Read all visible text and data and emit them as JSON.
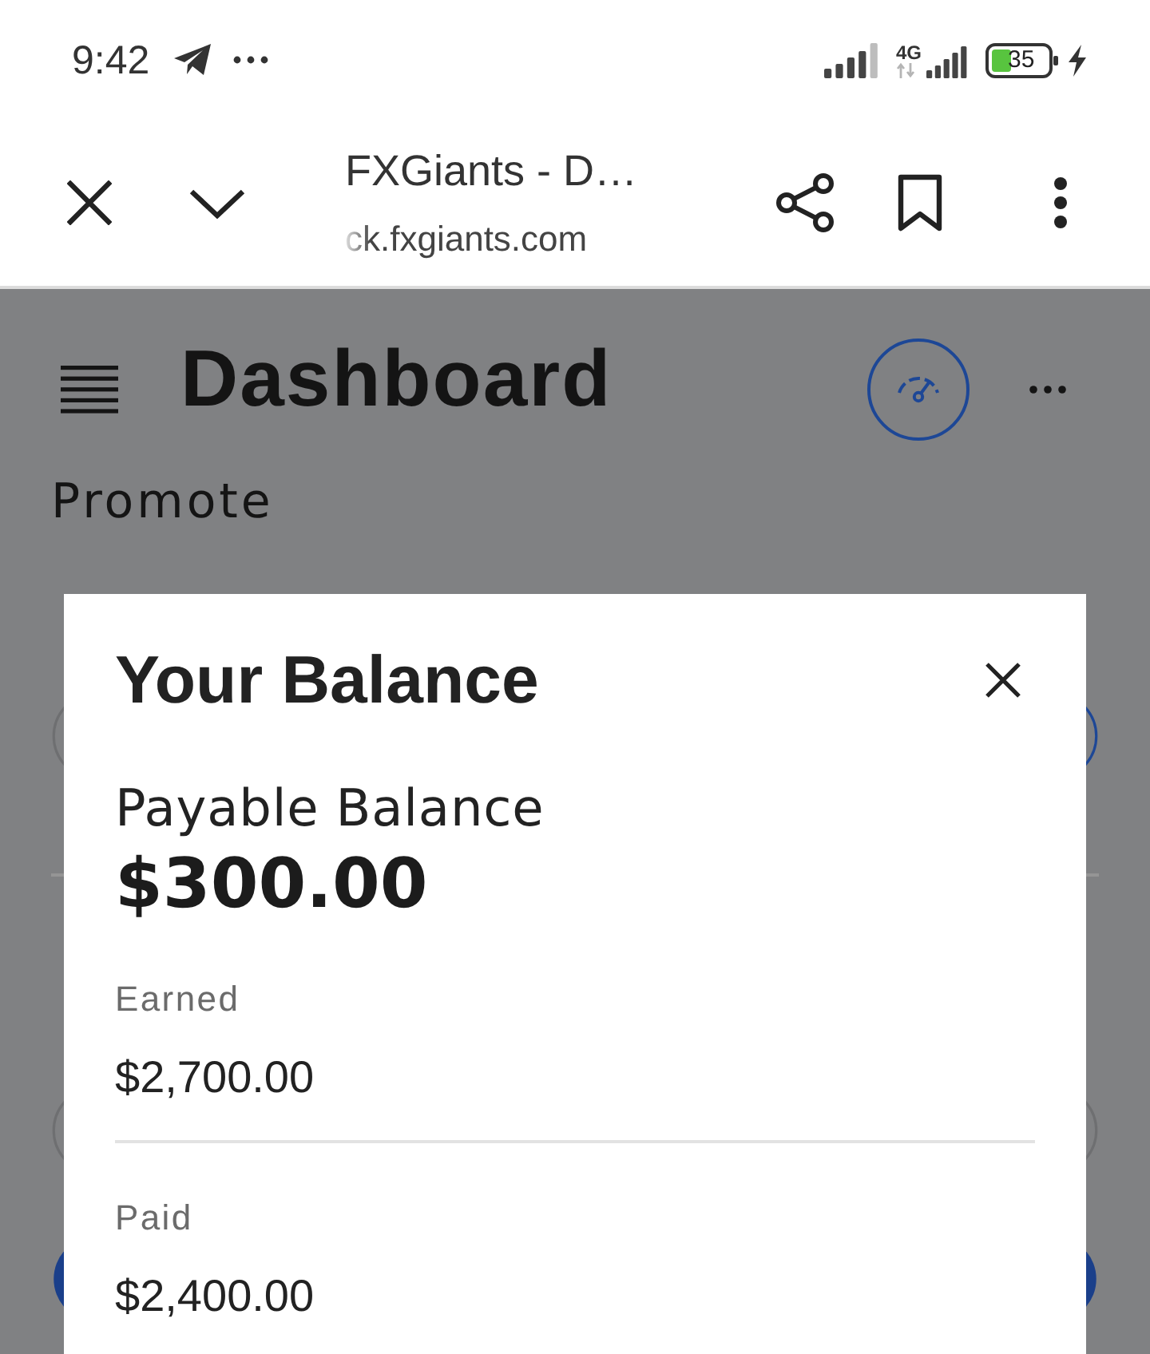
{
  "status_bar": {
    "time": "9:42",
    "network_label": "4G",
    "battery": "35"
  },
  "browser_toolbar": {
    "page_title": "FXGiants - D…",
    "url": "ck.fxgiants.com"
  },
  "page": {
    "title": "Dashboard",
    "section_label": "Promote"
  },
  "modal": {
    "title": "Your Balance",
    "balance_label": "Payable Balance",
    "balance_value": "$300.00",
    "entries": [
      {
        "label": "Earned",
        "value": "$2,700.00"
      },
      {
        "label": "Paid",
        "value": "$2,400.00"
      }
    ]
  }
}
